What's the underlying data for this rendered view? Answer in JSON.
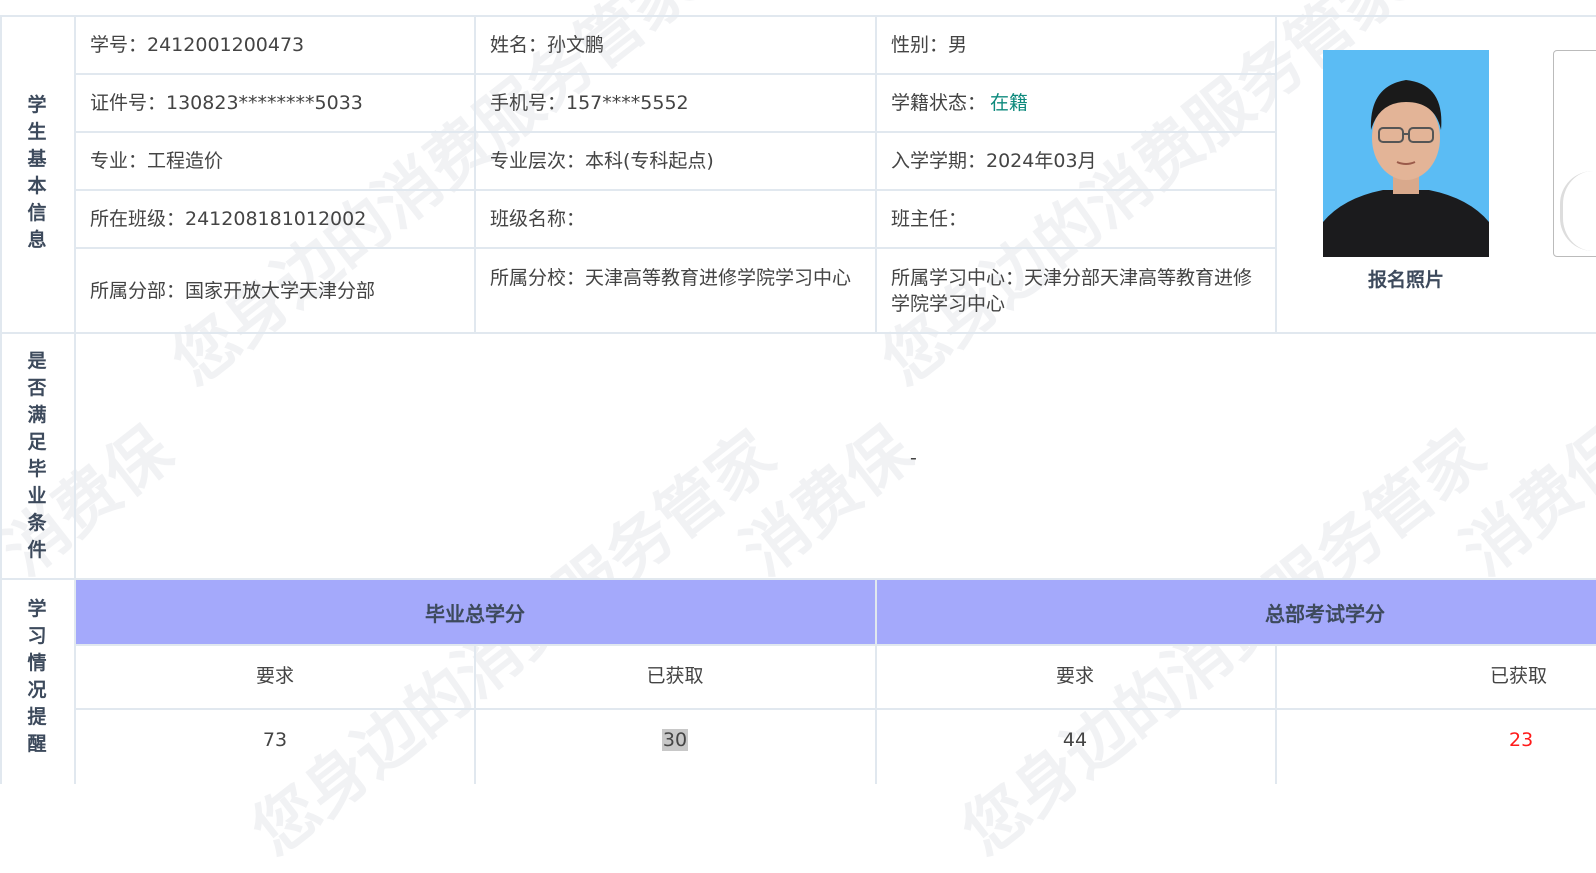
{
  "student_info": {
    "section_title": "学生基本信息",
    "rows": [
      [
        "学号：2412001200473",
        "姓名：孙文鹏",
        "性别：男"
      ],
      [
        "证件号：130823********5033",
        "手机号：157****5552"
      ],
      [
        "专业：工程造价",
        "专业层次：本科(专科起点)",
        "入学学期：2024年03月"
      ],
      [
        "所在班级：241208181012002",
        "班级名称：",
        "班主任："
      ],
      [
        "所属分部：国家开放大学天津分部",
        "所属分校：天津高等教育进修学院学习中心",
        "所属学习中心：天津分部天津高等教育进修学院学习中心"
      ]
    ],
    "status_label": "学籍状态：",
    "status_value": "在籍",
    "photo_caption": "报名照片"
  },
  "graduation": {
    "section_title": "是否满足毕业条件",
    "value": "-"
  },
  "study": {
    "section_title": "学习情况提醒",
    "groups": [
      "毕业总学分",
      "总部考试学分"
    ],
    "subheaders": [
      "要求",
      "已获取",
      "要求",
      "已获取"
    ],
    "values": [
      "73",
      "30",
      "44",
      "23"
    ]
  },
  "watermark": "您身边的消费服务管家 消费保",
  "colors": {
    "header_band": "#a4a9fb",
    "status_green": "#0e8a7d",
    "alert_red": "#ff1a1a",
    "photo_bg": "#5bbcf4"
  }
}
